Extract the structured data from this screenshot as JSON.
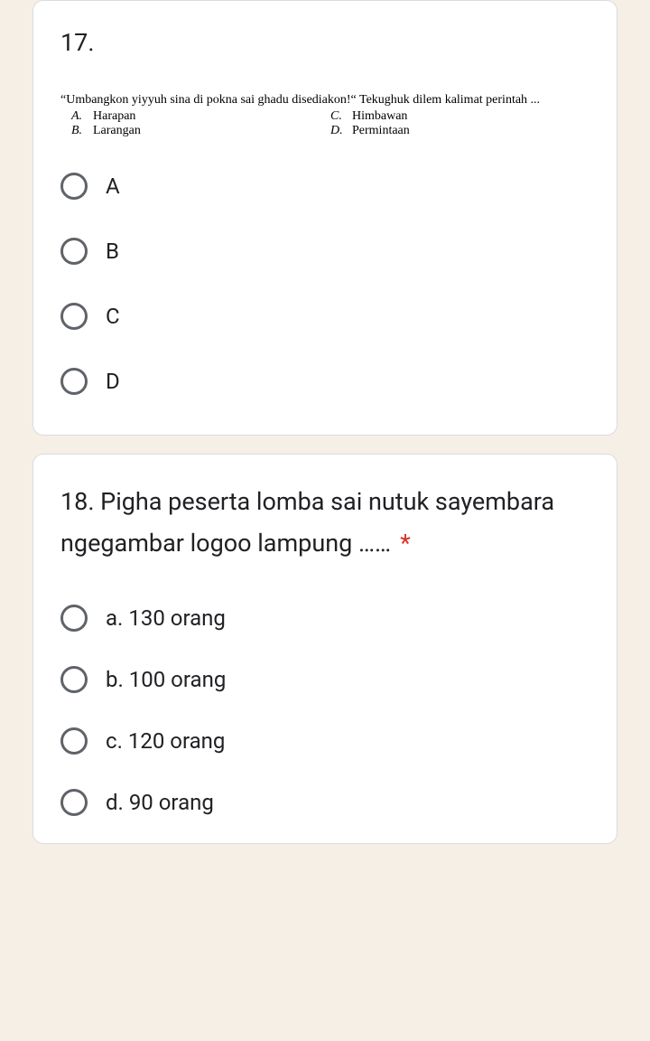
{
  "q17": {
    "number": "17.",
    "embedded": {
      "intro": "“Umbangkon yiyyuh sina di pokna sai ghadu disediakon!“ Tekughuk dilem kalimat perintah ...",
      "A": "Harapan",
      "B": "Larangan",
      "C": "Himbawan",
      "D": "Permintaan"
    },
    "options": [
      "A",
      "B",
      "C",
      "D"
    ]
  },
  "q18": {
    "title": "18.  Pigha peserta lomba sai nutuk sayembara ngegambar logoo lampung ……",
    "required": "*",
    "options": [
      "a. 130 orang",
      "b. 100 orang",
      "c. 120 orang",
      "d. 90 orang"
    ]
  }
}
